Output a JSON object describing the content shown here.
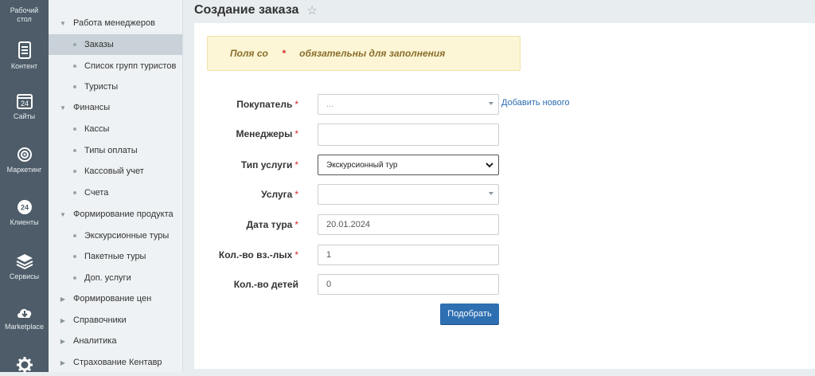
{
  "rail": [
    {
      "label": "Рабочий стол",
      "icon": "desktop-icon"
    },
    {
      "label": "Контент",
      "icon": "content-icon"
    },
    {
      "label": "Сайты",
      "icon": "calendar-icon"
    },
    {
      "label": "Маркетинг",
      "icon": "target-icon"
    },
    {
      "label": "Клиенты",
      "icon": "clients-24-icon"
    },
    {
      "label": "Сервисы",
      "icon": "layers-icon"
    },
    {
      "label": "Marketplace",
      "icon": "cloud-download-icon"
    },
    {
      "label": "",
      "icon": "gear-icon"
    }
  ],
  "menu": [
    {
      "label": "Работа менеджеров",
      "type": "group",
      "expanded": true
    },
    {
      "label": "Заказы",
      "type": "item",
      "active": true
    },
    {
      "label": "Список групп туристов",
      "type": "item"
    },
    {
      "label": "Туристы",
      "type": "item"
    },
    {
      "label": "Финансы",
      "type": "group",
      "expanded": true
    },
    {
      "label": "Кассы",
      "type": "item"
    },
    {
      "label": "Типы оплаты",
      "type": "item"
    },
    {
      "label": "Кассовый учет",
      "type": "item"
    },
    {
      "label": "Счета",
      "type": "item"
    },
    {
      "label": "Формирование продукта",
      "type": "group",
      "expanded": true
    },
    {
      "label": "Экскурсионные туры",
      "type": "item"
    },
    {
      "label": "Пакетные туры",
      "type": "item"
    },
    {
      "label": "Доп. услуги",
      "type": "item"
    },
    {
      "label": "Формирование цен",
      "type": "group",
      "expanded": false
    },
    {
      "label": "Справочники",
      "type": "group",
      "expanded": false
    },
    {
      "label": "Аналитика",
      "type": "group",
      "expanded": false
    },
    {
      "label": "Страхование Кентавр",
      "type": "group",
      "expanded": false
    }
  ],
  "header": {
    "title": "Создание заказа"
  },
  "notice": {
    "prefix": "Поля со ",
    "star": "*",
    "suffix": " обязательны для заполнения"
  },
  "form": {
    "buyer": {
      "label": "Покупатель",
      "required": "*",
      "value": "...",
      "add_link": "Добавить нового"
    },
    "managers": {
      "label": "Менеджеры",
      "required": "*",
      "value": ""
    },
    "service_type": {
      "label": "Тип услуги",
      "required": "*",
      "value": "Экскурсионный тур"
    },
    "service": {
      "label": "Услуга",
      "required": "*",
      "value": ""
    },
    "tour_date": {
      "label": "Дата тура",
      "required": "*",
      "value": "20.01.2024"
    },
    "adults": {
      "label": "Кол.-во вз.-лых",
      "required": "*",
      "value": "1"
    },
    "children": {
      "label": "Кол.-во детей",
      "required": "",
      "value": "0"
    },
    "submit_label": "Подобрать"
  },
  "colors": {
    "rail": "#4d5c68",
    "menu": "#eef2f4",
    "accent": "#2e6fb2",
    "required": "#d62b2b",
    "notice_bg": "#fcf6d6"
  }
}
